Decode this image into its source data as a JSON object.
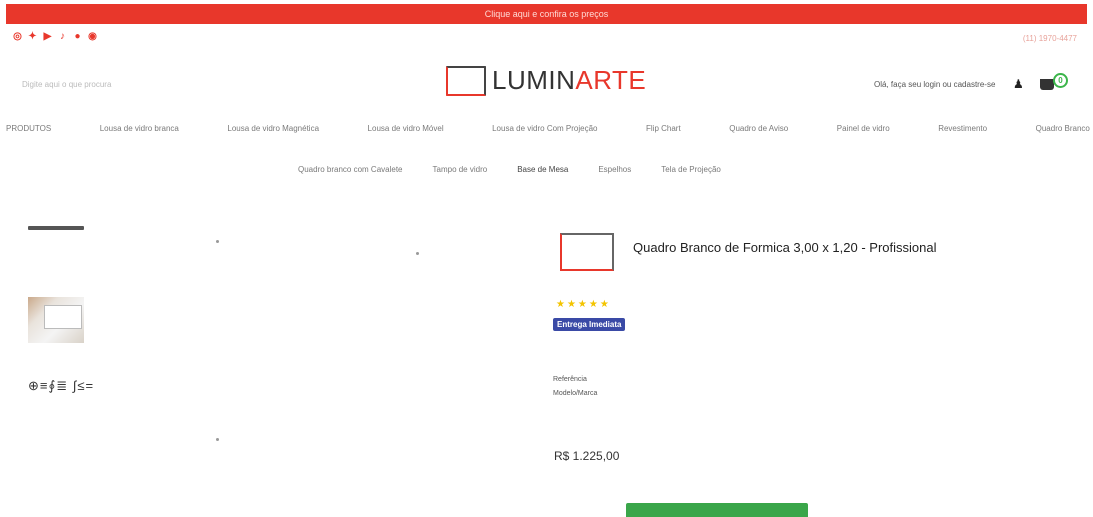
{
  "topbar": {
    "text": "Clique aqui e confira os preços"
  },
  "social_icons": [
    {
      "name": "instagram-icon",
      "glyph": "◎"
    },
    {
      "name": "twitter-icon",
      "glyph": "✦"
    },
    {
      "name": "youtube-icon",
      "glyph": "▶"
    },
    {
      "name": "tiktok-icon",
      "glyph": "♪"
    },
    {
      "name": "github-icon",
      "glyph": "●"
    },
    {
      "name": "pinterest-icon",
      "glyph": "◉"
    }
  ],
  "header": {
    "phone": "(11) 1970-4477",
    "search_hint": "Digite aqui o que procura",
    "logo_part1": "LUMIN",
    "logo_part2": "ARTE",
    "user_link": "Olá, faça seu login ou cadastre-se",
    "cart_count": "0"
  },
  "nav": {
    "row1": [
      "PRODUTOS",
      "Lousa de vidro branca",
      "Lousa de vidro Magnética",
      "Lousa de vidro Móvel",
      "Lousa de vidro Com Projeção",
      "Flip Chart",
      "Quadro de Aviso",
      "Painel de vidro",
      "Revestimento",
      "Quadro Branco"
    ],
    "row2": [
      "Quadro branco com Cavalete",
      "Tampo de vidro",
      "Base de Mesa",
      "Espelhos",
      "Tela de Projeção"
    ]
  },
  "gallery": {
    "math_text": "⊕≡∮≣ ∫≤="
  },
  "product": {
    "title": "Quadro Branco de Formica 3,00 x 1,20 - Profissional",
    "stars": "★★★★★",
    "tag": "Entrega Imediata",
    "ref_label": "Referência",
    "model_label": "Modelo/Marca",
    "price": "R$ 1.225,00",
    "colors": {
      "accent": "#e8372b",
      "buy": "#3aa64a",
      "tag": "#3a4aa6"
    }
  }
}
